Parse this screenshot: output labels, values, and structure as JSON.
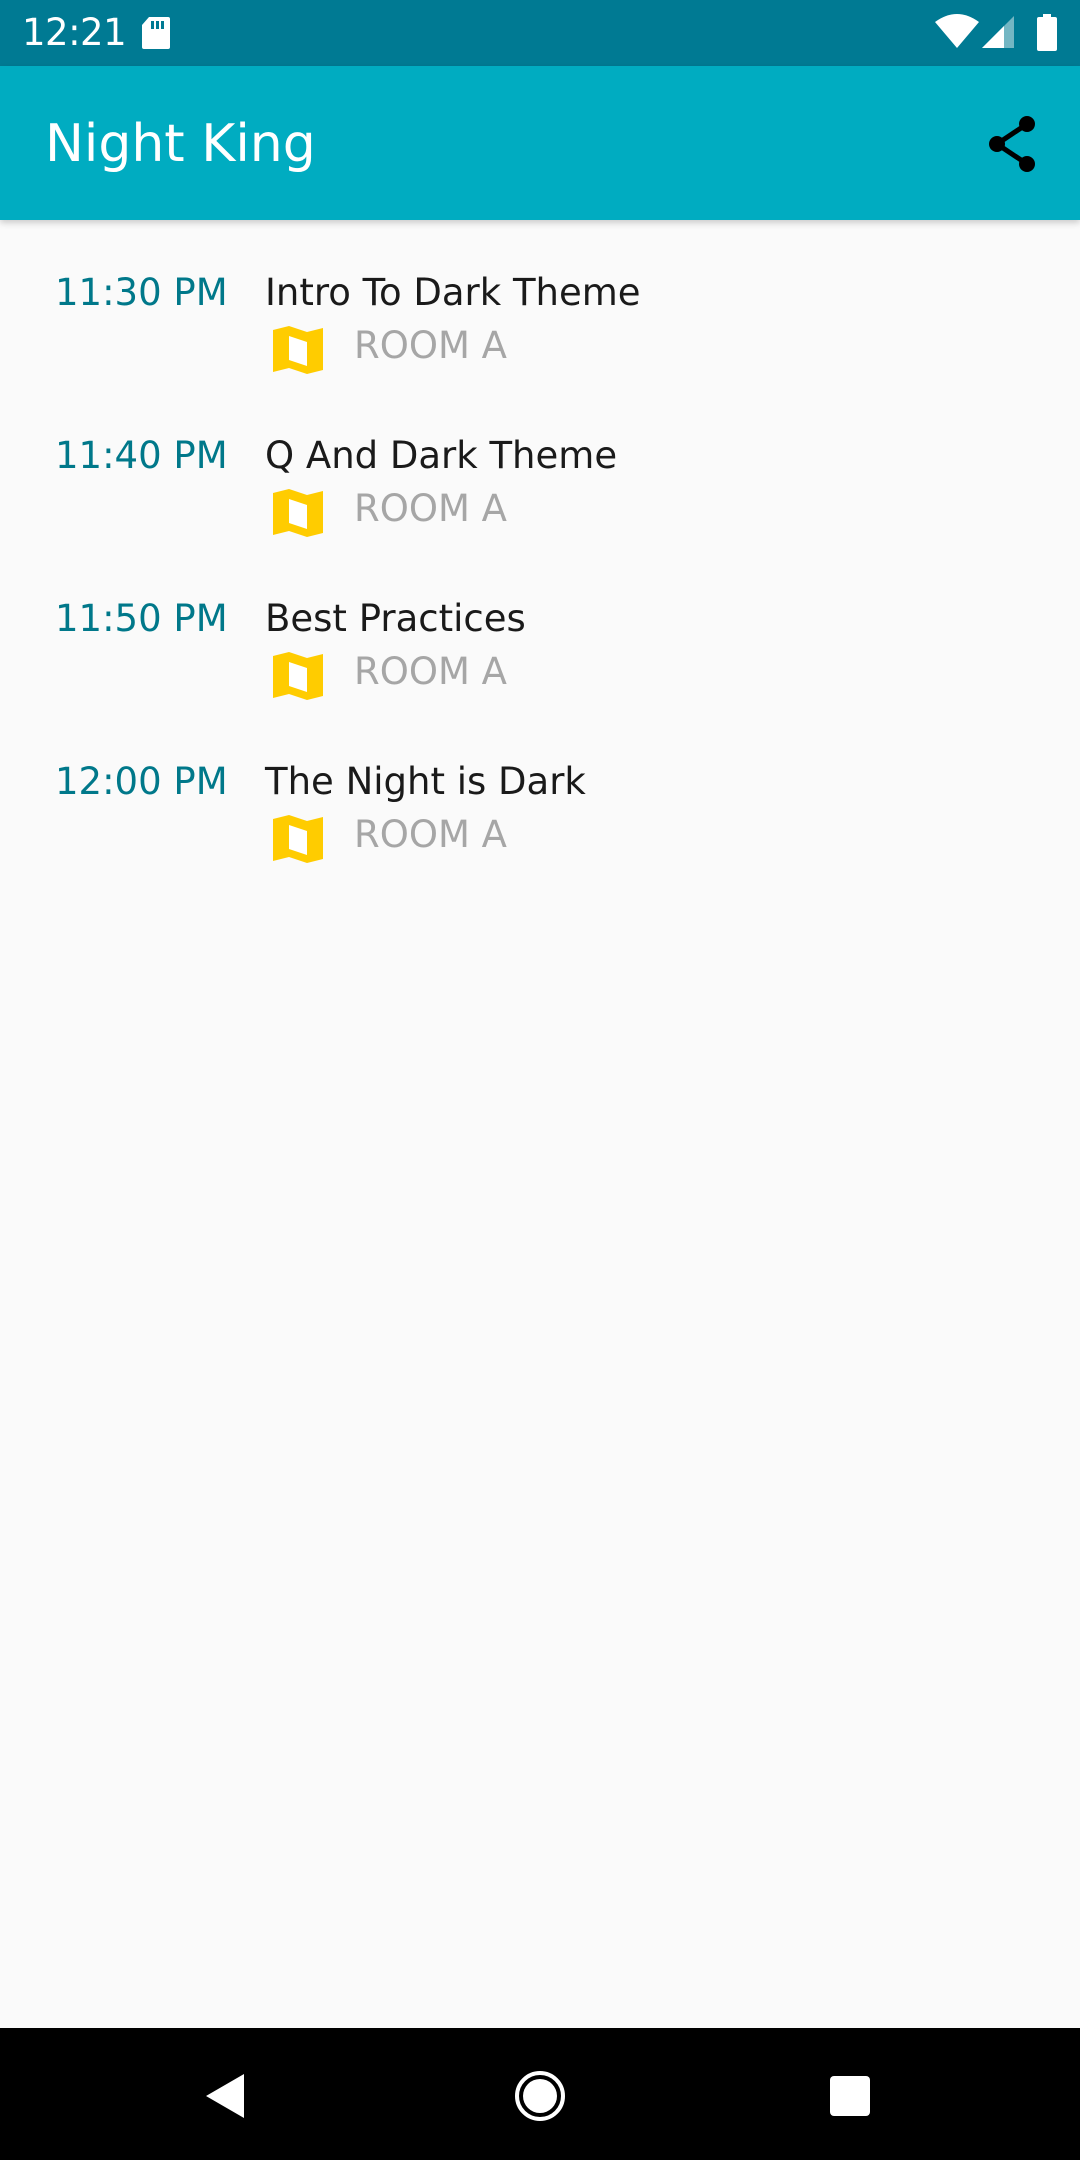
{
  "status_bar": {
    "time": "12:21",
    "icons": [
      "sd-card-icon",
      "wifi-icon",
      "cell-signal-icon",
      "battery-icon"
    ]
  },
  "app_bar": {
    "title": "Night King",
    "share_icon": "share-icon"
  },
  "sessions": [
    {
      "time": "11:30 PM",
      "title": "Intro To Dark Theme",
      "room": "ROOM A",
      "icon": "map-icon"
    },
    {
      "time": "11:40 PM",
      "title": "Q And Dark Theme",
      "room": "ROOM A",
      "icon": "map-icon"
    },
    {
      "time": "11:50 PM",
      "title": "Best Practices",
      "room": "ROOM A",
      "icon": "map-icon"
    },
    {
      "time": "12:00 PM",
      "title": "The Night is Dark",
      "room": "ROOM A",
      "icon": "map-icon"
    }
  ],
  "nav_bar": {
    "icons": [
      "back-icon",
      "home-icon",
      "recents-icon"
    ]
  },
  "colors": {
    "status_bar": "#007a93",
    "app_bar": "#00acc1",
    "time_text": "#00788a",
    "room_text": "#a6a6a6",
    "map_icon": "#ffcc00",
    "background": "#fafafa"
  }
}
